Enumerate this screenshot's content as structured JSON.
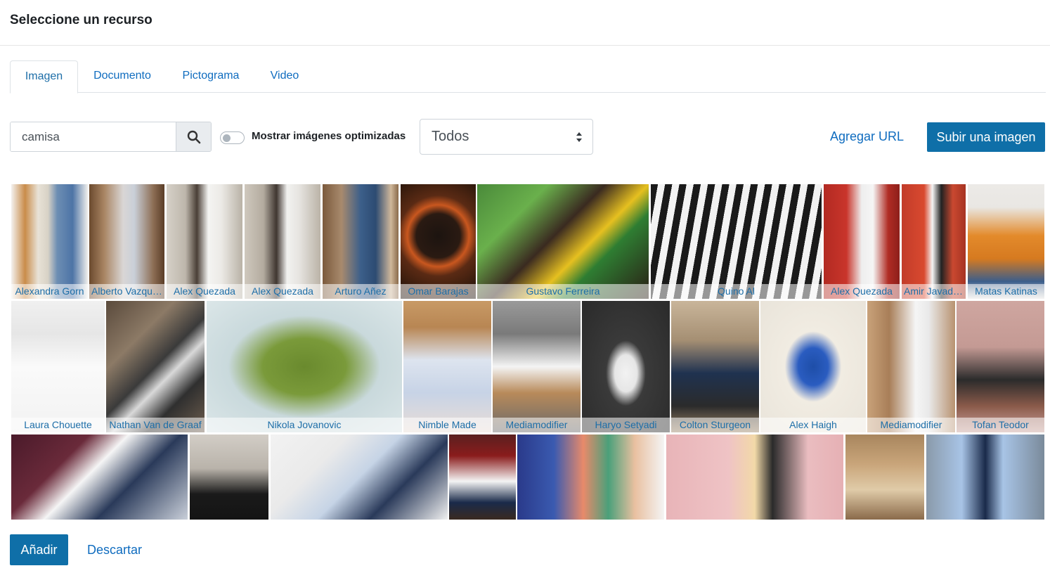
{
  "dialog": {
    "title": "Seleccione un recurso"
  },
  "tabs": [
    {
      "label": "Imagen",
      "active": true
    },
    {
      "label": "Documento",
      "active": false
    },
    {
      "label": "Pictograma",
      "active": false
    },
    {
      "label": "Video",
      "active": false
    }
  ],
  "search": {
    "value": "camisa",
    "icon": "search-icon"
  },
  "toggle": {
    "label": "Mostrar imágenes optimizadas",
    "checked": false
  },
  "filter": {
    "selected": "Todos"
  },
  "actions": {
    "add_url": "Agregar URL",
    "upload": "Subir una imagen"
  },
  "footer": {
    "add": "Añadir",
    "discard": "Descartar"
  },
  "colors": {
    "accent": "#0f6fa8",
    "link": "#0f6cbf"
  },
  "gallery": {
    "row1": [
      {
        "author": "Alexandra Gorn"
      },
      {
        "author": "Alberto Vazquez"
      },
      {
        "author": "Alex Quezada"
      },
      {
        "author": "Alex Quezada"
      },
      {
        "author": "Arturo Añez"
      },
      {
        "author": "Omar Barajas"
      },
      {
        "author": "Gustavo Ferreira"
      },
      {
        "author": "Quino Al"
      },
      {
        "author": "Alex Quezada"
      },
      {
        "author": "Amir Javadz..."
      },
      {
        "author": "Matas Katinas"
      }
    ],
    "row2": [
      {
        "author": "Laura Chouette"
      },
      {
        "author": "Nathan Van de Graaf"
      },
      {
        "author": "Nikola Jovanovic"
      },
      {
        "author": "Nimble Made"
      },
      {
        "author": "Mediamodifier"
      },
      {
        "author": "Haryo Setyadi"
      },
      {
        "author": "Colton Sturgeon"
      },
      {
        "author": "Alex Haigh"
      },
      {
        "author": "Mediamodifier"
      },
      {
        "author": "Tofan Teodor"
      }
    ],
    "row3": [
      {},
      {},
      {},
      {},
      {},
      {},
      {},
      {}
    ]
  }
}
